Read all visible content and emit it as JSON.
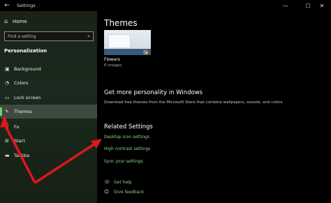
{
  "window": {
    "title": "Settings",
    "back_glyph": "←",
    "min_glyph": "—",
    "max_glyph": "☐",
    "close_glyph": "✕"
  },
  "sidebar": {
    "home_label": "Home",
    "search_placeholder": "Find a setting",
    "section": "Personalization",
    "items": [
      {
        "label": "Background",
        "icon": "image-icon",
        "glyph": "▣"
      },
      {
        "label": "Colors",
        "icon": "palette-icon",
        "glyph": "◔"
      },
      {
        "label": "Lock screen",
        "icon": "lock-screen-icon",
        "glyph": "▭"
      },
      {
        "label": "Themes",
        "icon": "brush-icon",
        "glyph": "✎"
      },
      {
        "label": "Fo",
        "icon": "font-icon",
        "glyph": "A"
      },
      {
        "label": "Start",
        "icon": "start-icon",
        "glyph": "⊞"
      },
      {
        "label": "Taskba",
        "icon": "taskbar-icon",
        "glyph": "▬"
      }
    ],
    "accent_color": "#67d36a"
  },
  "main": {
    "title": "Themes",
    "current_theme": {
      "name": "Flowers",
      "count": "6 images"
    },
    "personality": {
      "heading": "Get more personality in Windows",
      "description": "Download free themes from the Microsoft Store that combine wallpapers, sounds, and colors"
    },
    "related": {
      "heading": "Related Settings",
      "links": [
        "Desktop icon settings",
        "High contrast settings",
        "Sync your settings"
      ]
    },
    "help": [
      {
        "label": "Get help",
        "icon": "help-icon",
        "glyph": "☏"
      },
      {
        "label": "Give feedback",
        "icon": "feedback-icon",
        "glyph": "☺"
      }
    ],
    "link_color": "#8fcf8f"
  },
  "annotation": {
    "arrow_color": "#e0161c"
  }
}
